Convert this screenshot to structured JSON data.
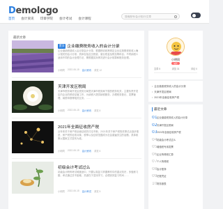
{
  "header": {
    "logo_first": "D",
    "logo_rest": "emologo",
    "nav": [
      "首页",
      "会计资讯",
      "印章学院",
      "会计考试",
      "会计课程"
    ],
    "search_placeholder": "搜索账号/会计知识/文章"
  },
  "main": {
    "section_title": "最新文章",
    "articles": [
      {
        "tag": "置顶",
        "title": "企业缴费税务收入的会计分录",
        "summary": "企业缴纳税费收入后记录会计分录，根据税收政策规定企业应按照税收收入确认相关的会计分录，具体包括应交税费、营业税金及附加等科目，不同纳税人适用不同的会计处理方法，需根据实际情况进行会计核算和账务处理。",
        "meta": [
          "小明同",
          "2022-06-15",
          "会计资讯",
          "浏览 12"
        ]
      },
      {
        "tag": "",
        "title": "天津开发区税局",
        "summary": "天津市税务局开发区税务分局是天津市税务局下属的税务机关，主要负责开发区内企业的税收征管工作，为纳税人提供纳税服务，办理税务登记、发票管理、纳税申报等相关业务，……",
        "meta": [
          "小明同",
          "2022-06-15",
          "会计资讯",
          "浏览 8"
        ]
      },
      {
        "tag": "",
        "title": "2021年全面征收房产税",
        "summary": "近年来关于房产税全面征收的讨论不断，2021年关于房产税的改革试点逐步推进，房产税的征收对象、税率以及征收范围成为社会普遍关注的话题，具体政策以国家正式发布为准。",
        "meta": [
          "小明同",
          "2022-06-15",
          "会计资讯",
          "浏览 6"
        ]
      },
      {
        "tag": "",
        "title": "初级会计考试过么",
        "summary": "初级会计职称考试难度适中，只要认真复习掌握教材中的重点知识，多做练习题，考试通过并不困难，关键在于坚持学习，合理安排复习时间……",
        "meta": [
          "小明同",
          "2022-06-15",
          "会计考试",
          "浏览 5"
        ]
      }
    ]
  },
  "profile": {
    "name": "小明同",
    "badge": "站长",
    "stats": [
      "文章 5",
      "浏览 31",
      "评论 0"
    ]
  },
  "related": [
    "企业缴费税务收入的会计分录",
    "天津开发区税局",
    "2021年全面征收房产税"
  ],
  "recent": {
    "title": "最近文章",
    "items": [
      "企业缴费税务收入的会计分录",
      "天津开发区税局",
      "2021年全面征收房产税",
      "初级会计考试过么",
      "增值税专用发票",
      "企业所得税汇算",
      "个人所得税",
      "会计账簿",
      "记账凭证",
      "财务报表"
    ]
  },
  "colors": {
    "accent": "#2b7fe0",
    "background": "#f1f2f4"
  }
}
